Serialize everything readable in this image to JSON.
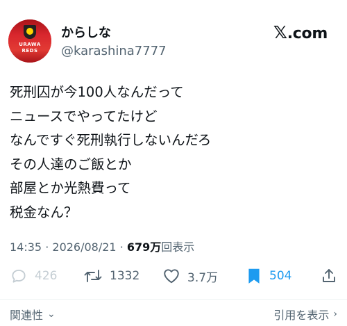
{
  "user": {
    "display_name": "からしな",
    "handle": "@karashina7777",
    "avatar_text_line1": "URAWA",
    "avatar_text_line2": "REDS"
  },
  "brand": {
    "logo_text": "X.com",
    "logo_mark": "𝕏",
    "logo_suffix": ".com"
  },
  "tweet": {
    "lines": [
      "死刑囚が今100人なんだって",
      "ニュースでやってたけど",
      "なんですぐ死刑執行しないんだろ",
      "その人達のご飯とか",
      "部屋とか光熱費って",
      "税金なん？"
    ],
    "time": "14:35",
    "date": "2026/08/21",
    "separator": "·",
    "views_count": "679万",
    "views_label": "回表示"
  },
  "actions": {
    "replies": "426",
    "retweets": "1332",
    "likes": "3.7万",
    "bookmarks": "504"
  },
  "footer": {
    "related_label": "関連性",
    "quotes_label": "引用を表示"
  },
  "colors": {
    "text": "#0f1419",
    "muted": "#536471",
    "accent": "#1d9bf0"
  }
}
